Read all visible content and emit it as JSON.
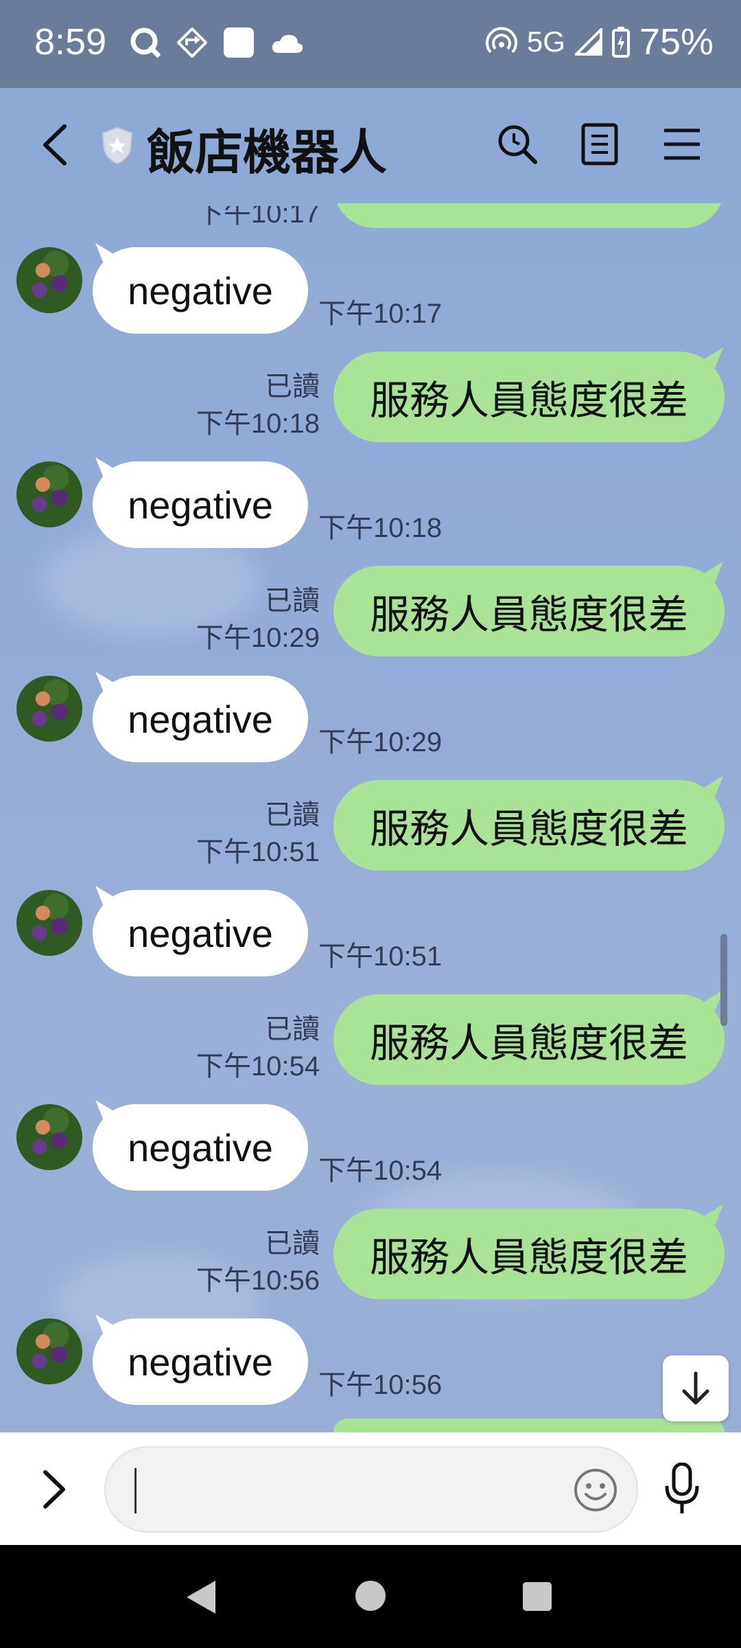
{
  "status_bar": {
    "time": "8:59",
    "network": "5G",
    "battery": "75%"
  },
  "header": {
    "title": "飯店機器人"
  },
  "messages": [
    {
      "side": "left",
      "text": "negative",
      "time": "下午10:17"
    },
    {
      "side": "right",
      "text": "服務人員態度很差",
      "read": "已讀",
      "time": "下午10:18"
    },
    {
      "side": "left",
      "text": "negative",
      "time": "下午10:18"
    },
    {
      "side": "right",
      "text": "服務人員態度很差",
      "read": "已讀",
      "time": "下午10:29"
    },
    {
      "side": "left",
      "text": "negative",
      "time": "下午10:29"
    },
    {
      "side": "right",
      "text": "服務人員態度很差",
      "read": "已讀",
      "time": "下午10:51"
    },
    {
      "side": "left",
      "text": "negative",
      "time": "下午10:51"
    },
    {
      "side": "right",
      "text": "服務人員態度很差",
      "read": "已讀",
      "time": "下午10:54"
    },
    {
      "side": "left",
      "text": "negative",
      "time": "下午10:54"
    },
    {
      "side": "right",
      "text": "服務人員態度很差",
      "read": "已讀",
      "time": "下午10:56"
    },
    {
      "side": "left",
      "text": "negative",
      "time": "下午10:56"
    }
  ],
  "top_partial_time": "下午10:17",
  "input": {
    "value": ""
  },
  "colors": {
    "chat_bg": "#94abd7",
    "status_bar": "#6b7c9a",
    "bubble_self": "#a8e396",
    "bubble_other": "#ffffff"
  },
  "icons": {
    "back": "chevron-left-icon",
    "badge": "shield-icon",
    "search": "search-icon",
    "notes": "notes-icon",
    "menu": "menu-icon",
    "expand": "chevron-right-icon",
    "emoji": "emoji-icon",
    "mic": "microphone-icon",
    "scroll_down": "arrow-down-icon"
  }
}
